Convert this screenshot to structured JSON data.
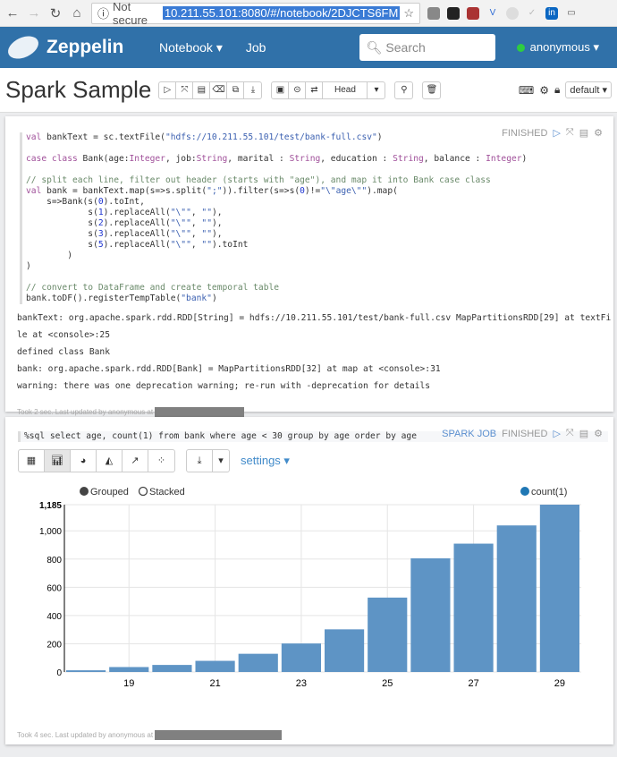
{
  "browser": {
    "security": "Not secure",
    "url": "10.211.55.101:8080/#/notebook/2DJCTS6FM"
  },
  "navbar": {
    "brand": "Zeppelin",
    "notebook": "Notebook ▾",
    "job": "Job",
    "search_placeholder": "Search",
    "user": "anonymous ▾"
  },
  "notebook": {
    "title": "Spark Sample",
    "head_label": "Head",
    "interpreter": "default ▾"
  },
  "para1": {
    "status": "FINISHED",
    "output": [
      "bankText: org.apache.spark.rdd.RDD[String] = hdfs://10.211.55.101/test/bank-full.csv MapPartitionsRDD[29] at textFi",
      "le at <console>:25",
      "defined class Bank",
      "bank: org.apache.spark.rdd.RDD[Bank] = MapPartitionsRDD[32] at map at <console>:31",
      "warning: there was one deprecation warning; re-run with -deprecation for details"
    ],
    "footer": "Took 2 sec. Last updated by anonymous at"
  },
  "para2": {
    "code": "%sql select age, count(1) from bank where age < 30 group by age order by age",
    "spark_job": "SPARK JOB",
    "status": "FINISHED",
    "settings": "settings ▾",
    "footer": "Took 4 sec. Last updated by anonymous at"
  },
  "chart_data": {
    "type": "bar",
    "x": [
      18,
      19,
      20,
      21,
      22,
      23,
      24,
      25,
      26,
      27,
      28,
      29
    ],
    "values": [
      12,
      35,
      50,
      79,
      129,
      202,
      302,
      527,
      805,
      909,
      1038,
      1185
    ],
    "series": [
      {
        "name": "count(1)",
        "color": "#5e94c5"
      }
    ],
    "xticks": [
      "19",
      "21",
      "23",
      "25",
      "27",
      "29"
    ],
    "yticks": [
      "0",
      "200",
      "400",
      "600",
      "800",
      "1,000",
      "1,185"
    ],
    "ylim": [
      0,
      1185
    ],
    "legend": {
      "grouped": "Grouped",
      "stacked": "Stacked",
      "series": "count(1)",
      "placement": "top-right"
    },
    "grid": true
  }
}
